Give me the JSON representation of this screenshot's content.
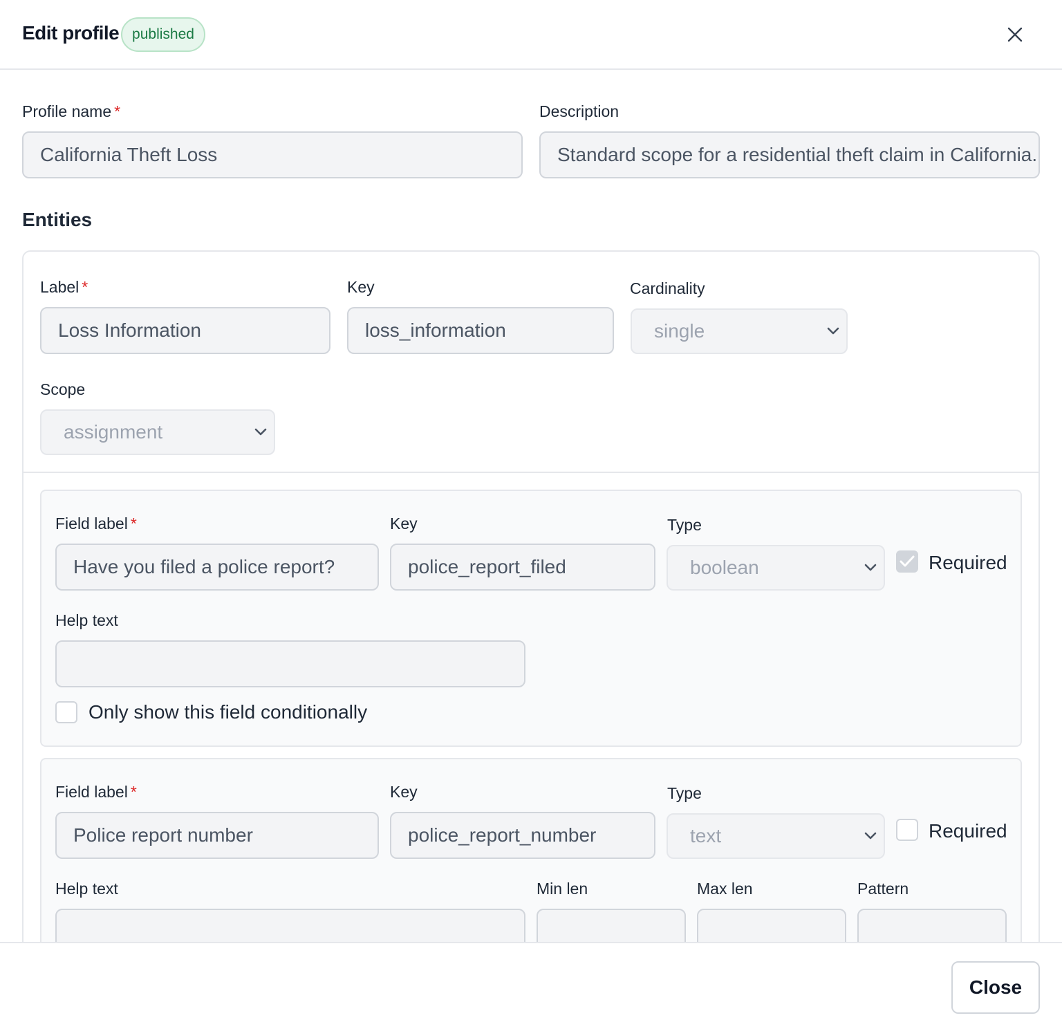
{
  "dialog": {
    "title": "Edit profile",
    "status_badge": "published",
    "close_button": "Close"
  },
  "profile": {
    "name_label": "Profile name",
    "name_value": "California Theft Loss",
    "description_label": "Description",
    "description_value": "Standard scope for a residential theft claim in California."
  },
  "entities_title": "Entities",
  "entity": {
    "label_label": "Label",
    "label_value": "Loss Information",
    "key_label": "Key",
    "key_value": "loss_information",
    "cardinality_label": "Cardinality",
    "cardinality_value": "single",
    "scope_label": "Scope",
    "scope_value": "assignment",
    "fields": [
      {
        "field_label_label": "Field label",
        "field_label_value": "Have you filed a police report?",
        "key_label": "Key",
        "key_value": "police_report_filed",
        "type_label": "Type",
        "type_value": "boolean",
        "required_label": "Required",
        "required": true,
        "help_label": "Help text",
        "help_value": "",
        "conditional_label": "Only show this field conditionally",
        "conditional": false
      },
      {
        "field_label_label": "Field label",
        "field_label_value": "Police report number",
        "key_label": "Key",
        "key_value": "police_report_number",
        "type_label": "Type",
        "type_value": "text",
        "required_label": "Required",
        "required": false,
        "help_label": "Help text",
        "help_value": "",
        "min_len_label": "Min len",
        "max_len_label": "Max len",
        "pattern_label": "Pattern"
      }
    ]
  },
  "colors": {
    "badge_bg": "#e7f6ed",
    "badge_text": "#1b7a44",
    "required_star": "#dc2626"
  }
}
